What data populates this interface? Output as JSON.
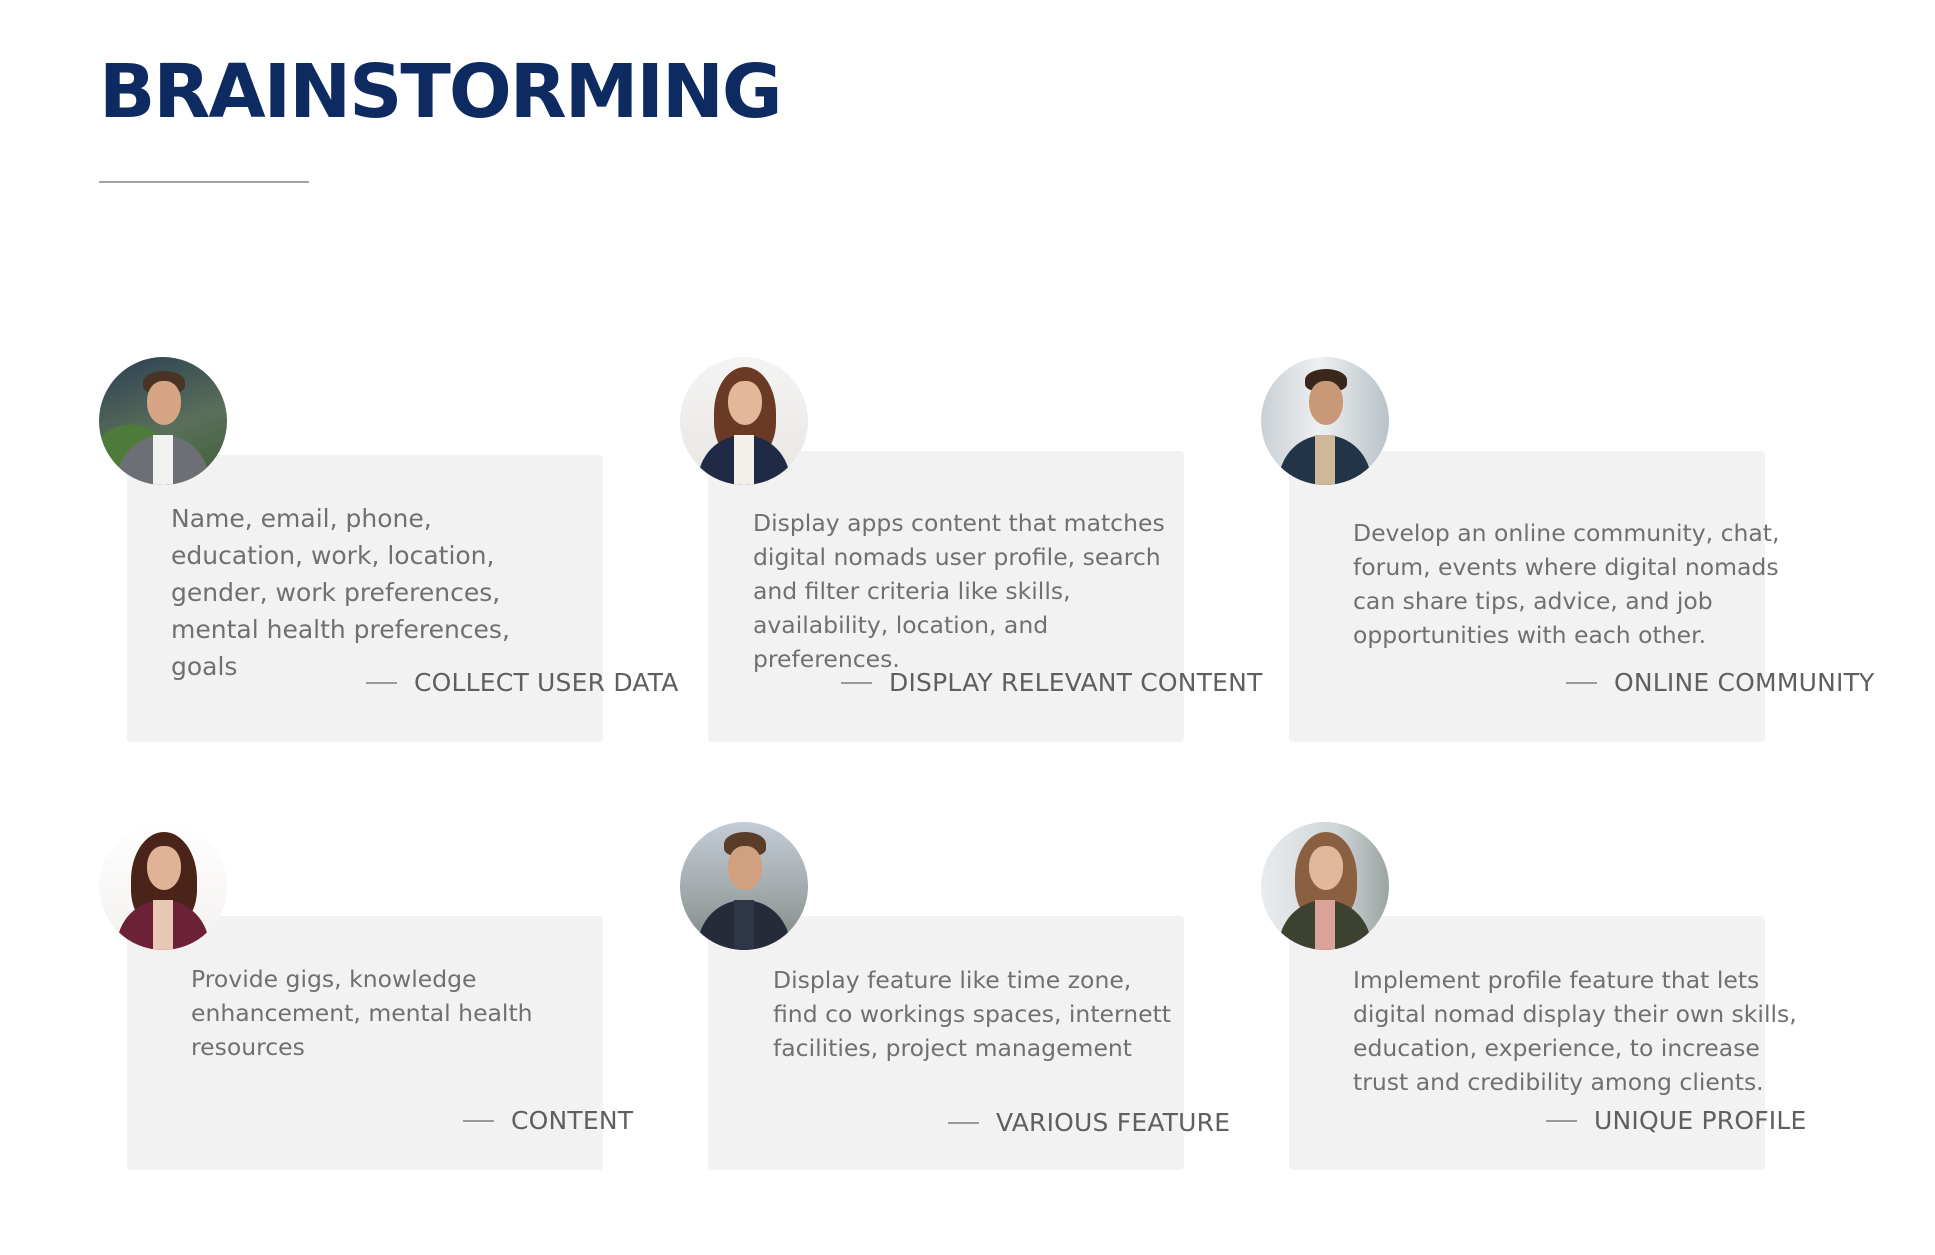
{
  "page": {
    "title": "BRAINSTORMING"
  },
  "cards": [
    {
      "caption": "COLLECT USER DATA",
      "body": "Name, email, phone, education, work, location, gender, work preferences, mental health preferences, goals",
      "avatar": "man-portrait-icon"
    },
    {
      "caption": "DISPLAY RELEVANT CONTENT",
      "body": "Display apps content that matches digital nomads user profile, search and filter criteria like skills, availability, location, and preferences.",
      "avatar": "woman-portrait-icon"
    },
    {
      "caption": "ONLINE COMMUNITY",
      "body": "Develop an online community, chat, forum, events where digital nomads can share tips, advice, and job opportunities with each other.",
      "avatar": "man-portrait-icon"
    },
    {
      "caption": "CONTENT",
      "body": "Provide gigs, knowledge enhancement, mental health resources",
      "avatar": "woman-portrait-icon"
    },
    {
      "caption": "VARIOUS FEATURE",
      "body": "Display feature like time zone, find co workings spaces, internett facilities, project management",
      "avatar": "man-portrait-icon"
    },
    {
      "caption": "UNIQUE PROFILE",
      "body": "Implement profile feature that lets digital nomad display their own skills, education, experience, to increase trust and credibility among clients.",
      "avatar": "woman-portrait-icon"
    }
  ],
  "colors": {
    "title": "#0d2b61",
    "card_bg": "#f2f2f2",
    "body_text": "#707070",
    "caption_text": "#5f5f5f"
  }
}
